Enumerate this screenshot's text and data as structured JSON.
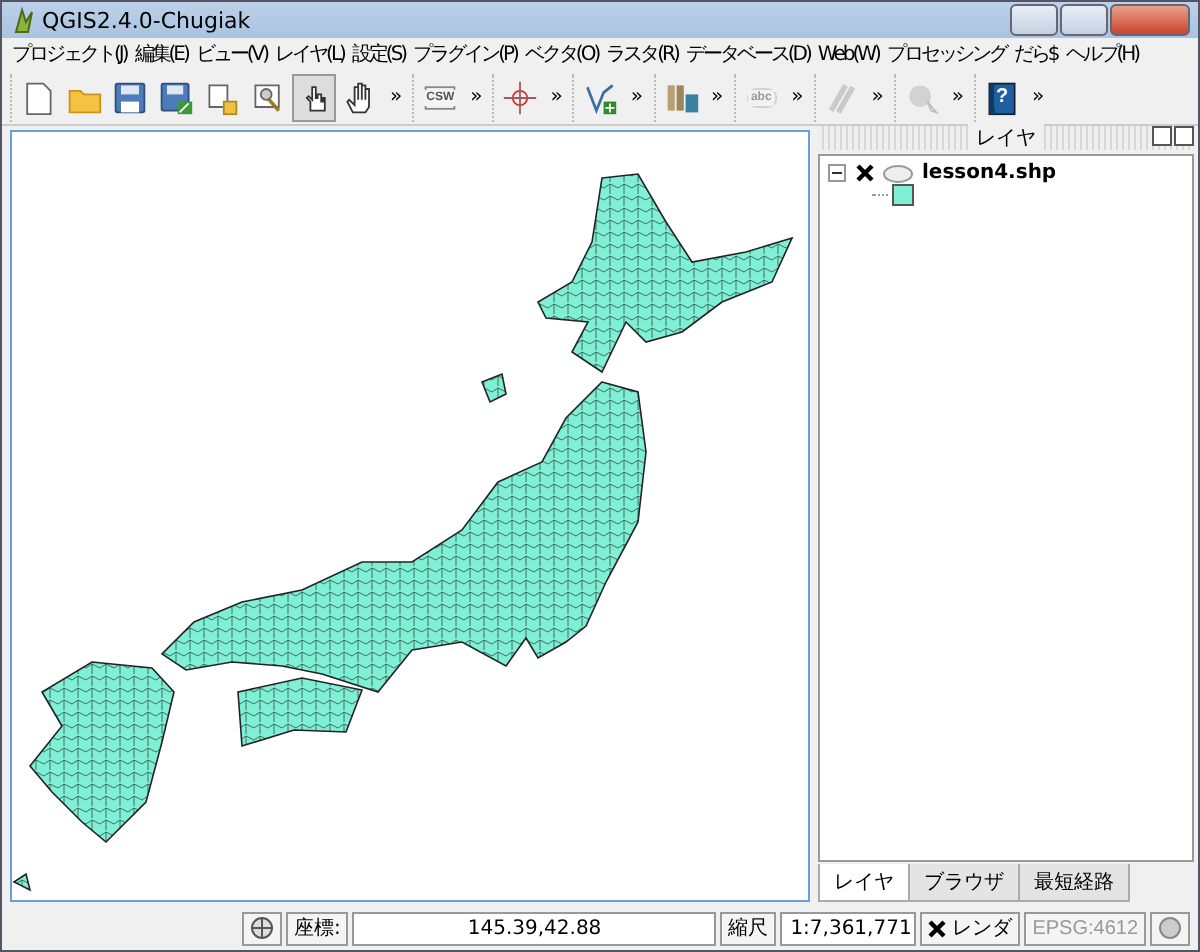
{
  "window": {
    "title": "QGIS2.4.0-Chugiak"
  },
  "menu": [
    "プロジェクト(J)",
    "編集(E)",
    "ビュー(V)",
    "レイヤ(L)",
    "設定(S)",
    "プラグイン(P)",
    "ベクタ(O)",
    "ラスタ(R)",
    "データベース(D)",
    "Web(W)",
    "プロセッシング",
    "だら$",
    "ヘルプ(H)"
  ],
  "toolbar": [
    {
      "buttons": [
        {
          "selected": false,
          "disabled": false
        },
        {
          "selected": false,
          "disabled": false
        },
        {
          "selected": false,
          "disabled": false
        },
        {
          "selected": false,
          "disabled": false
        },
        {
          "selected": false,
          "disabled": false
        },
        {
          "selected": false,
          "disabled": false
        },
        {
          "selected": true,
          "disabled": false
        },
        {
          "selected": false,
          "disabled": false
        }
      ],
      "overflow": "»"
    },
    {
      "buttons": [
        {
          "selected": false,
          "disabled": false,
          "label": "CSW"
        }
      ],
      "overflow": "»"
    },
    {
      "buttons": [
        {
          "selected": false,
          "disabled": false
        }
      ],
      "overflow": "»"
    },
    {
      "buttons": [
        {
          "selected": false,
          "disabled": false
        }
      ],
      "overflow": "»"
    },
    {
      "buttons": [
        {
          "selected": false,
          "disabled": false
        }
      ],
      "overflow": "»"
    },
    {
      "buttons": [
        {
          "selected": false,
          "disabled": true,
          "label": "abc"
        }
      ],
      "overflow": "»"
    },
    {
      "buttons": [
        {
          "selected": false,
          "disabled": true
        }
      ],
      "overflow": "»"
    },
    {
      "buttons": [
        {
          "selected": false,
          "disabled": true
        }
      ],
      "overflow": "»"
    },
    {
      "buttons": [
        {
          "selected": false,
          "disabled": false,
          "label": "?"
        }
      ],
      "overflow": "»"
    }
  ],
  "layers_panel": {
    "title": "レイヤ",
    "layers": [
      {
        "name": "lesson4.shp",
        "expanded": true,
        "checked": true
      }
    ],
    "tabs": [
      {
        "label": "レイヤ",
        "selected": true
      },
      {
        "label": "ブラウザ",
        "selected": false
      },
      {
        "label": "最短経路",
        "selected": false
      }
    ]
  },
  "status_bar": {
    "coordinate_label": "座標:",
    "coordinate": "145.39,42.88",
    "scale_label": "縮尺",
    "scale": "1:7,361,771",
    "render_label": "レンダ",
    "render": true,
    "crs": "EPSG:4612"
  }
}
